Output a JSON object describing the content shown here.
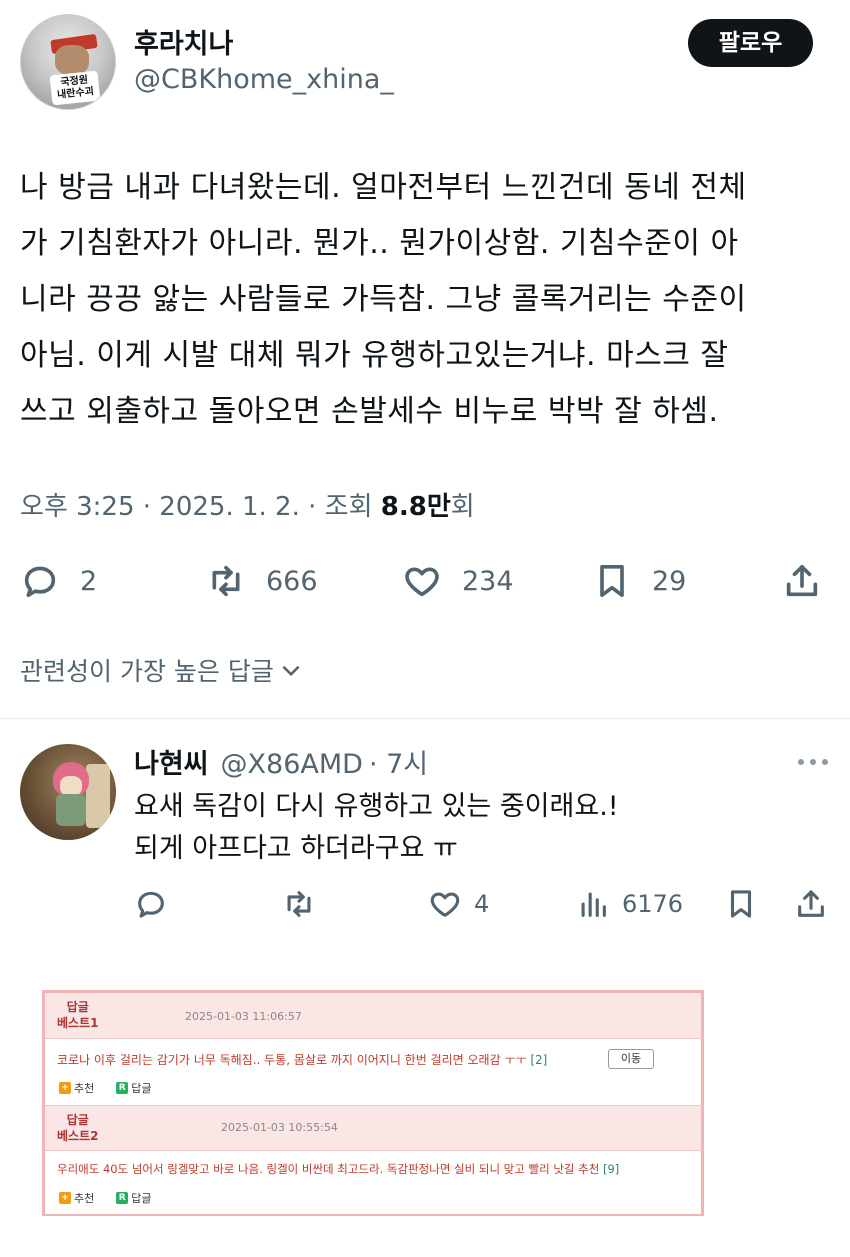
{
  "tweet": {
    "author_name": "후라치나",
    "author_handle": "@CBKhome_xhina_",
    "avatar_sticker": "국정원\n내란수괴",
    "follow_label": "팔로우",
    "text": "나 방금 내과 다녀왔는데. 얼마전부터 느낀건데 동네 전체\n가 기침환자가 아니라. 뭔가.. 뭔가이상함. 기침수준이 아\n니라 끙끙 앓는 사람들로 가득참. 그냥 콜록거리는 수준이\n아님. 이게 시발 대체 뭐가 유행하고있는거냐. 마스크 잘\n쓰고 외출하고 돌아오면 손발세수 비누로 박박 잘 하셈.",
    "time": "오후 3:25 · 2025. 1. 2. · 조회 ",
    "views": "8.8만",
    "views_suffix": "회",
    "stats": {
      "replies": "2",
      "retweets": "666",
      "likes": "234",
      "bookmarks": "29"
    },
    "icons": [
      "reply-icon",
      "retweet-icon",
      "like-icon",
      "bookmark-icon",
      "share-icon"
    ]
  },
  "replies_sort": {
    "label": "관련성이 가장 높은 답글"
  },
  "reply": {
    "author_name": "나현씨",
    "author_handle": "@X86AMD",
    "time": "· 7시",
    "text": "요새 독감이 다시 유행하고 있는 중이래요.!\n되게 아프다고 하더라구요 ㅠ",
    "stats": {
      "likes": "4",
      "views": "6176"
    },
    "icons": [
      "reply-icon",
      "retweet-icon",
      "like-icon",
      "analytics-icon",
      "bookmark-icon",
      "share-icon"
    ]
  },
  "embedded_image": {
    "comments": [
      {
        "rank_line1": "답글",
        "rank_line2": "베스트1",
        "date": "2025-01-03 11:06:57",
        "text": "코로나 이후 걸리는 감기가 너무 독해짐.. 두통, 몸살로 까지 이어지니 한번 걸리면 오래감 ㅜㅜ",
        "count": "[2]",
        "move_label": "이동",
        "recommend_label": "추천",
        "reply_label": "답글"
      },
      {
        "rank_line1": "답글",
        "rank_line2": "베스트2",
        "date": "2025-01-03 10:55:54",
        "text": "우리애도 40도 넘어서 링겔맞고 바로 나음. 링겔이 비싼데 최고드라. 독감판정나면 실비 되니 맞고 빨리 낫길 추천",
        "count": "[9]",
        "recommend_label": "추천",
        "reply_label": "답글"
      }
    ]
  },
  "colors": {
    "text": "#0f1419",
    "secondary": "#536471",
    "follow_bg": "#0f1419",
    "comment_red": "#c0392b",
    "embed_border": "#f1b4b4"
  }
}
